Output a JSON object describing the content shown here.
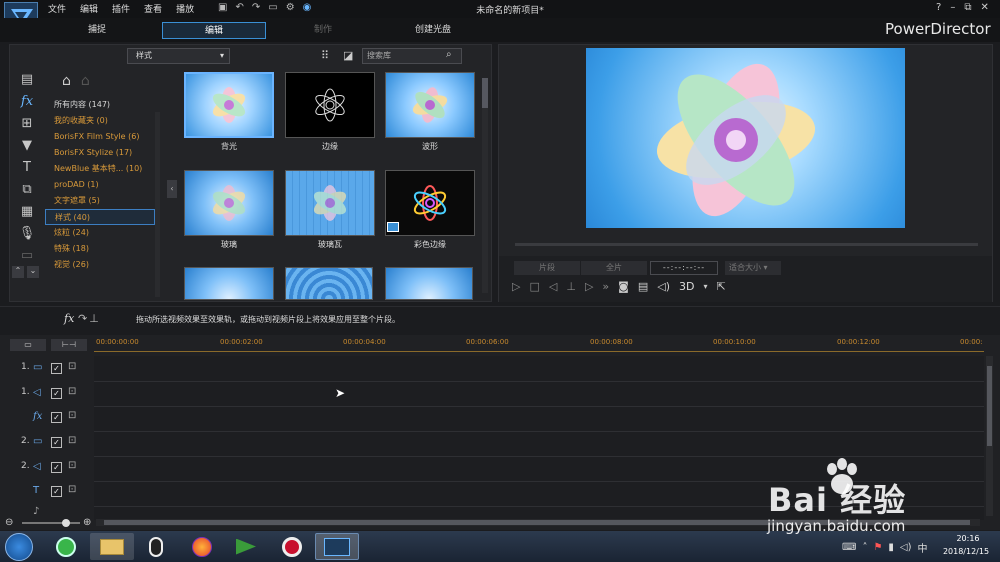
{
  "titlebar": {
    "menus": [
      "文件",
      "编辑",
      "插件",
      "查看",
      "播放"
    ],
    "title": "未命名的新项目*",
    "window_controls": [
      "?",
      "–",
      "⧉",
      "✕"
    ]
  },
  "modes": [
    "捕捉",
    "编辑",
    "制作",
    "创建光盘"
  ],
  "brand": "PowerDirector",
  "library": {
    "category_select": "样式",
    "search_placeholder": "搜索库",
    "categories": [
      {
        "label": "所有内容 (147)"
      },
      {
        "label": "我的收藏夹 (0)"
      },
      {
        "label": "BorisFX Film Style (6)"
      },
      {
        "label": "BorisFX Stylize (17)"
      },
      {
        "label": "NewBlue 基本特... (10)"
      },
      {
        "label": "proDAD (1)"
      },
      {
        "label": "文字遮罩 (5)"
      },
      {
        "label": "样式 (40)"
      },
      {
        "label": "炫粒 (24)"
      },
      {
        "label": "特殊 (18)"
      },
      {
        "label": "视觉 (26)"
      }
    ],
    "effects": [
      {
        "label": "背光"
      },
      {
        "label": "边缘"
      },
      {
        "label": "波形"
      },
      {
        "label": "玻璃"
      },
      {
        "label": "玻璃瓦"
      },
      {
        "label": "彩色边缘"
      }
    ]
  },
  "preview": {
    "mode_buttons": [
      "片段",
      "全片"
    ],
    "timecode": "--:--:--:--",
    "size_select": "适合大小",
    "three_d": "3D"
  },
  "hint": {
    "text": "拖动所选视频效果至效果轨，或拖动到视频片段上将效果应用至整个片段。"
  },
  "timeline": {
    "ticks": [
      "00:00:00:00",
      "00:00:02:00",
      "00:00:04:00",
      "00:00:06:00",
      "00:00:08:00",
      "00:00:10:00",
      "00:00:12:00",
      "00:00:"
    ],
    "tracks": [
      {
        "name": "1.",
        "icon": "video-icon"
      },
      {
        "name": "1.",
        "icon": "audio-icon"
      },
      {
        "name": "",
        "icon": "fx-icon"
      },
      {
        "name": "2.",
        "icon": "video-icon"
      },
      {
        "name": "2.",
        "icon": "audio-icon"
      },
      {
        "name": "",
        "icon": "title-icon"
      }
    ]
  },
  "taskbar": {
    "time": "20:16",
    "date": "2018/12/15"
  },
  "watermark": {
    "text": "Bai 经验",
    "url": "jingyan.baidu.com"
  }
}
